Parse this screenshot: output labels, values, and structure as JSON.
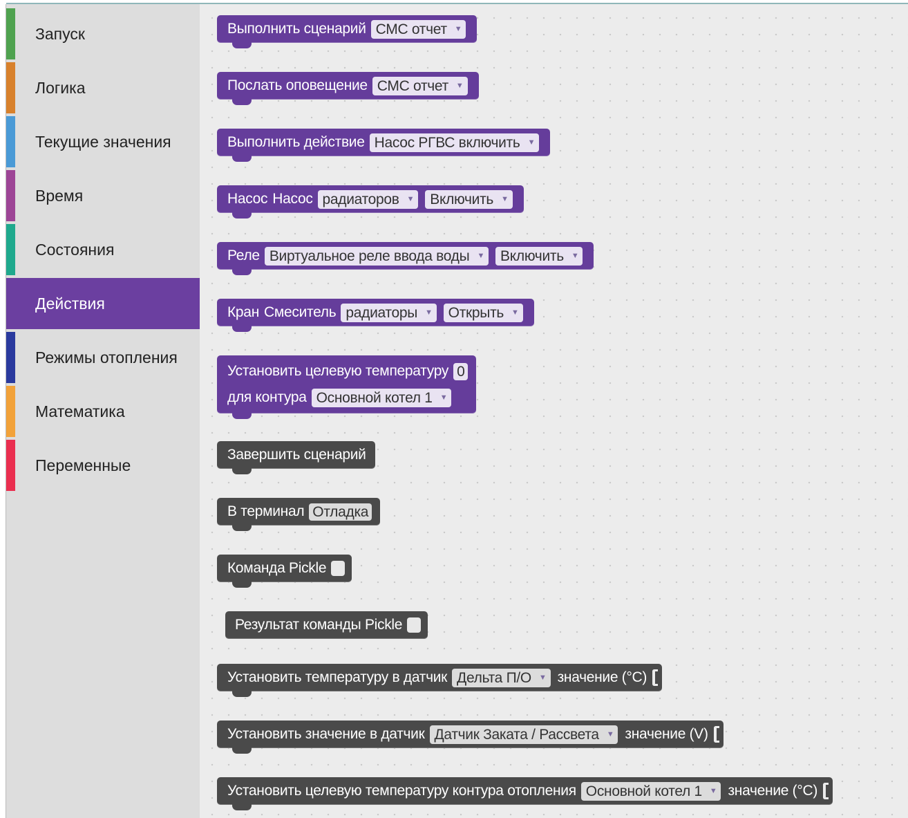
{
  "categories": [
    {
      "label": "Запуск",
      "color": "#4fa24f",
      "selected": false
    },
    {
      "label": "Логика",
      "color": "#d8812c",
      "selected": false
    },
    {
      "label": "Текущие значения",
      "color": "#4a9ad6",
      "selected": false
    },
    {
      "label": "Время",
      "color": "#9d4596",
      "selected": false
    },
    {
      "label": "Состояния",
      "color": "#1fa98d",
      "selected": false
    },
    {
      "label": "Действия",
      "color": "#6b3fa0",
      "selected": true
    },
    {
      "label": "Режимы отопления",
      "color": "#2a3a9e",
      "selected": false
    },
    {
      "label": "Математика",
      "color": "#f2a23a",
      "selected": false
    },
    {
      "label": "Переменные",
      "color": "#ea2e4f",
      "selected": false
    }
  ],
  "blocks": {
    "run_scenario": {
      "text": "Выполнить сценарий",
      "dropdown": "СМС отчет"
    },
    "send_notification": {
      "text": "Послать оповещение",
      "dropdown": "СМС отчет"
    },
    "do_action": {
      "text": "Выполнить действие",
      "dropdown": "Насос РГВС включить"
    },
    "pump": {
      "text1": "Насос",
      "text2": "Насос",
      "dropdown1": "радиаторов",
      "dropdown2": "Включить"
    },
    "relay": {
      "text": "Реле",
      "dropdown1": "Виртуальное реле ввода воды",
      "dropdown2": "Включить"
    },
    "valve": {
      "text1": "Кран",
      "text2": "Смеситель",
      "dropdown1": "радиаторы",
      "dropdown2": "Открыть"
    },
    "set_target_temp": {
      "text1": "Установить целевую температуру",
      "value": "0",
      "text2": "для контура",
      "dropdown": "Основной  котел 1"
    },
    "end_scenario": {
      "text": "Завершить сценарий"
    },
    "to_terminal": {
      "text": "В терминал",
      "dropdown": "Отладка"
    },
    "pickle_command": {
      "text": "Команда Pickle"
    },
    "pickle_result": {
      "text": "Результат команды Pickle"
    },
    "set_sensor_temp": {
      "text1": "Установить температуру в датчик",
      "dropdown": "Дельта П/О",
      "text2": "значение (°C)"
    },
    "set_sensor_value": {
      "text1": "Установить значение в датчик",
      "dropdown": "Датчик Заката / Рассвета",
      "text2": "значение (V)"
    },
    "set_circuit_temp": {
      "text1": "Установить целевую температуру контура отопления",
      "dropdown": "Основной  котел 1",
      "text2": "значение (°C)"
    }
  }
}
